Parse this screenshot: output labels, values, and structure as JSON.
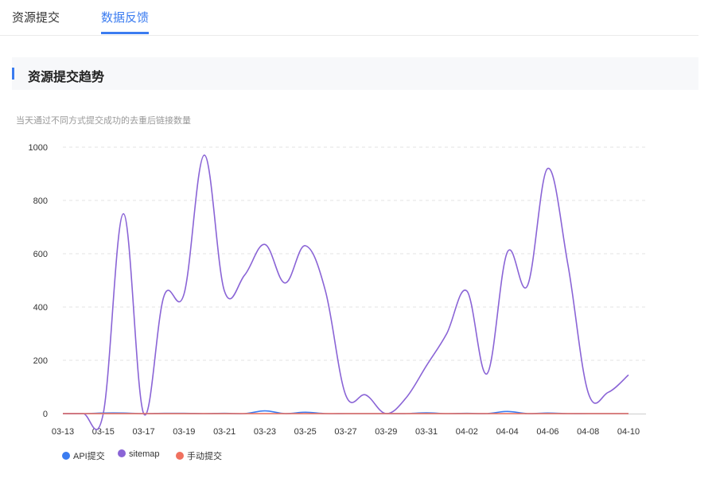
{
  "tabs": [
    {
      "label": "资源提交",
      "active": false
    },
    {
      "label": "数据反馈",
      "active": true
    }
  ],
  "section": {
    "title": "资源提交趋势"
  },
  "subtitle": "当天通过不同方式提交成功的去重后链接数量",
  "colors": {
    "accent": "#3b7cf0",
    "api": "#3b7cf0",
    "sitemap": "#8a64d6",
    "manual": "#f0715f"
  },
  "chart_data": {
    "type": "line",
    "title": "",
    "xlabel": "",
    "ylabel": "",
    "ylim": [
      0,
      1000
    ],
    "yticks": [
      "0",
      "200",
      "400",
      "600",
      "800",
      "1000"
    ],
    "grid": true,
    "legend_position": "bottom-left",
    "x": [
      "03-13",
      "03-14",
      "03-15",
      "03-16",
      "03-17",
      "03-18",
      "03-19",
      "03-20",
      "03-21",
      "03-22",
      "03-23",
      "03-24",
      "03-25",
      "03-26",
      "03-27",
      "03-28",
      "03-29",
      "03-30",
      "03-31",
      "04-01",
      "04-02",
      "04-03",
      "04-04",
      "04-05",
      "04-06",
      "04-07",
      "04-08",
      "04-09",
      "04-10"
    ],
    "xtick_labels": [
      "03-13",
      "03-15",
      "03-17",
      "03-19",
      "03-21",
      "03-23",
      "03-25",
      "03-27",
      "03-29",
      "03-31",
      "04-02",
      "04-04",
      "04-06",
      "04-08",
      "04-10"
    ],
    "series": [
      {
        "name": "API提交",
        "color": "#3b7cf0",
        "values": [
          0,
          0,
          2,
          2,
          0,
          1,
          1,
          0,
          1,
          0,
          10,
          0,
          5,
          0,
          0,
          0,
          0,
          0,
          3,
          0,
          1,
          0,
          8,
          0,
          2,
          0,
          0,
          0,
          0
        ]
      },
      {
        "name": "sitemap",
        "color": "#8a64d6",
        "values": [
          0,
          0,
          0,
          750,
          0,
          440,
          450,
          970,
          460,
          520,
          635,
          490,
          630,
          460,
          70,
          70,
          0,
          60,
          180,
          300,
          460,
          150,
          605,
          480,
          920,
          560,
          80,
          80,
          145
        ]
      },
      {
        "name": "手动提交",
        "color": "#f0715f",
        "values": [
          0,
          0,
          0,
          0,
          0,
          0,
          0,
          0,
          0,
          0,
          0,
          0,
          0,
          0,
          0,
          0,
          0,
          0,
          0,
          0,
          0,
          0,
          0,
          0,
          0,
          0,
          0,
          0,
          0
        ]
      }
    ]
  }
}
